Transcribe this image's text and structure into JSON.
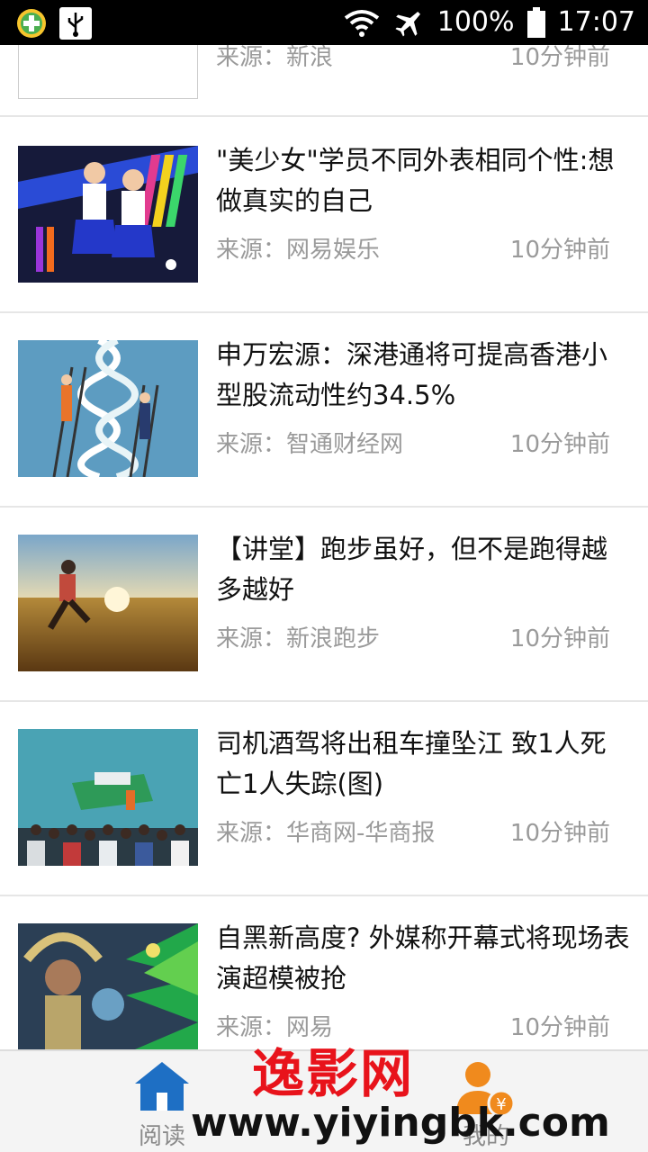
{
  "status_bar": {
    "battery": "100%",
    "time": "17:07",
    "icons": [
      "360-security-icon",
      "usb-icon",
      "wifi-icon",
      "airplane-mode-icon",
      "battery-icon"
    ]
  },
  "feed": {
    "partial_item": {
      "source": "来源：新浪",
      "time": "10分钟前"
    },
    "items": [
      {
        "title": "\"美少女\"学员不同外表相同个性:想做真实的自己",
        "source": "来源：网易娱乐",
        "time": "10分钟前",
        "thumb": "stage-performance-image"
      },
      {
        "title": "申万宏源：深港通将可提高香港小型股流动性约34.5%",
        "source": "来源：智通财经网",
        "time": "10分钟前",
        "thumb": "dna-ladder-illustration"
      },
      {
        "title": "【讲堂】跑步虽好，但不是跑得越多越好",
        "source": "来源：新浪跑步",
        "time": "10分钟前",
        "thumb": "runner-sunset-image"
      },
      {
        "title": "司机酒驾将出租车撞坠江 致1人死亡1人失踪(图)",
        "source": "来源：华商网-华商报",
        "time": "10分钟前",
        "thumb": "car-river-rescue-image"
      },
      {
        "title": "自黑新高度? 外媒称开幕式将现场表演超模被抢",
        "source": "来源：网易",
        "time": "10分钟前",
        "thumb": "carnival-dancer-image"
      }
    ]
  },
  "bottom_nav": {
    "read_label": "阅读",
    "mine_label": "我的"
  },
  "watermark": {
    "cn": "逸影网",
    "url": "www.yiyingbk.com"
  },
  "colors": {
    "accent_blue": "#1e6fc4",
    "accent_orange": "#f08a1d",
    "watermark_red": "#e8131b"
  }
}
